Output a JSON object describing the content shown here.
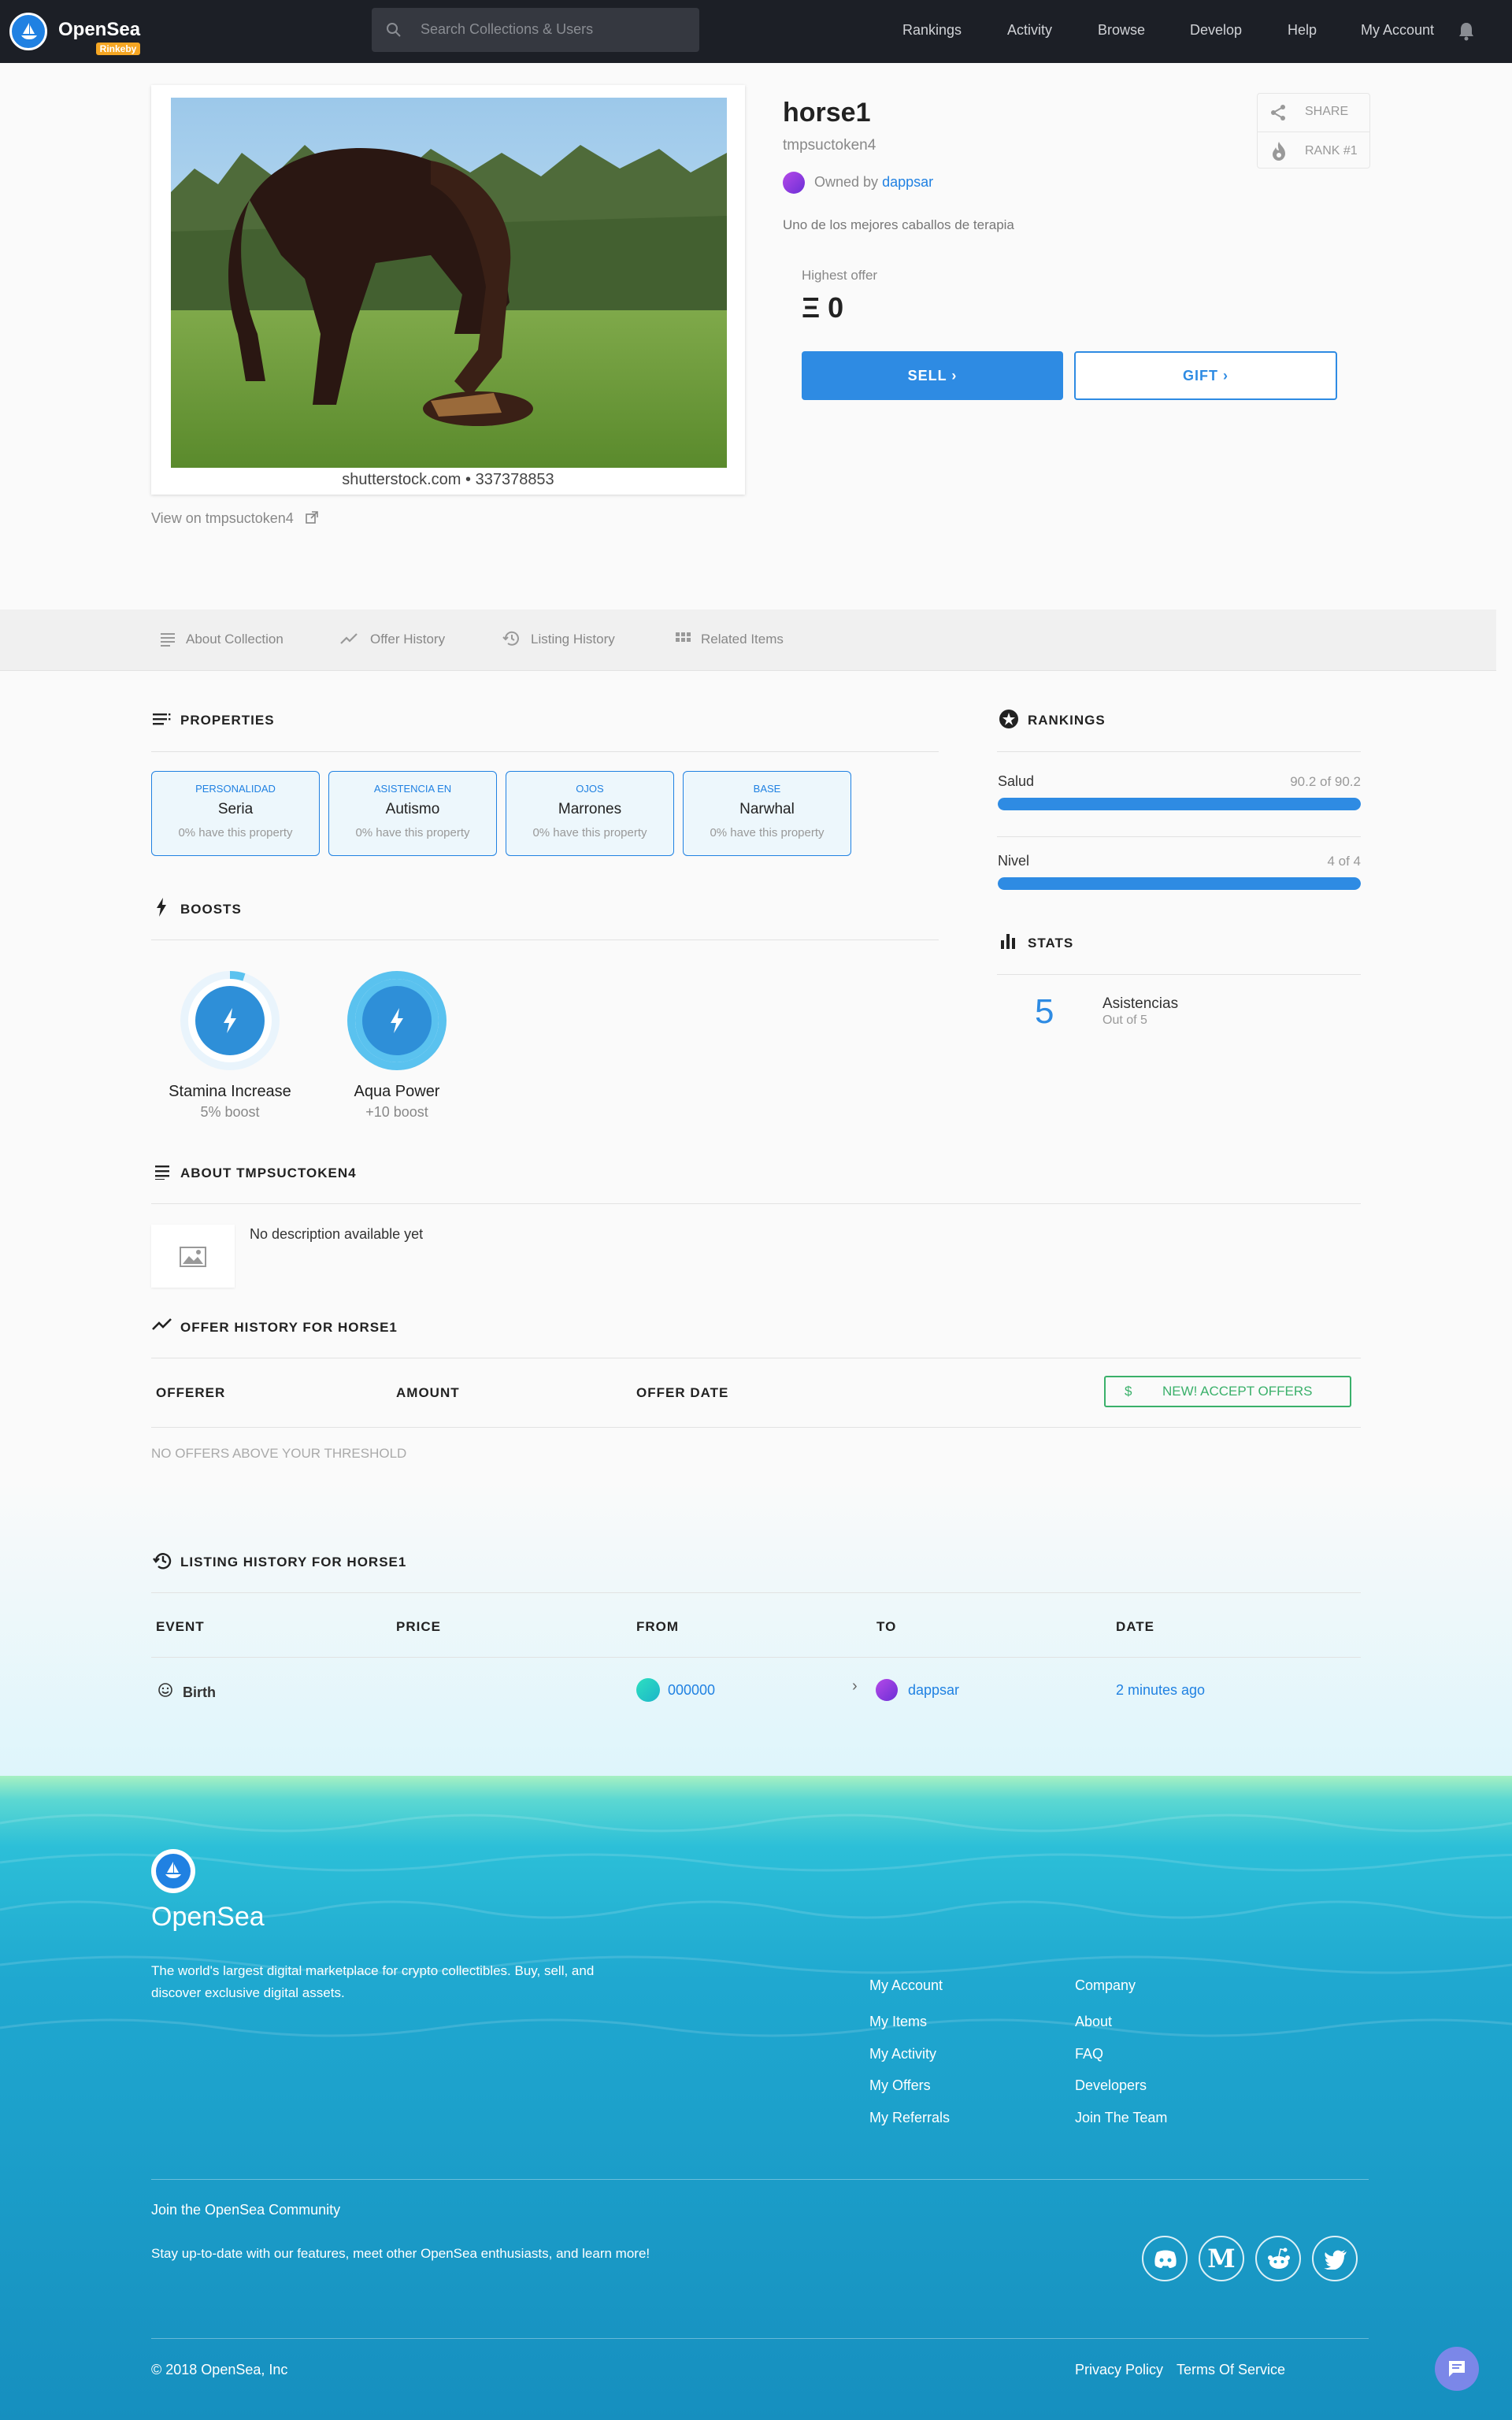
{
  "header": {
    "brand": "OpenSea",
    "network_badge": "Rinkeby",
    "search_placeholder": "Search Collections & Users",
    "nav": [
      "Rankings",
      "Activity",
      "Browse",
      "Develop",
      "Help",
      "My Account"
    ]
  },
  "asset": {
    "image_caption": "shutterstock.com • 337378853",
    "view_on": "View on tmpsuctoken4",
    "title": "horse1",
    "collection": "tmpsuctoken4",
    "owned_by_label": "Owned by",
    "owner": "dappsar",
    "description": "Uno de los mejores caballos de terapia",
    "highest_offer_label": "Highest offer",
    "highest_offer_value": "Ξ 0",
    "sell_label": "SELL",
    "gift_label": "GIFT",
    "share_label": "SHARE",
    "rank_label": "RANK #1"
  },
  "tabs": [
    "About Collection",
    "Offer History",
    "Listing History",
    "Related Items"
  ],
  "properties": {
    "heading": "PROPERTIES",
    "items": [
      {
        "type": "PERSONALIDAD",
        "value": "Seria",
        "rarity": "0% have this property"
      },
      {
        "type": "ASISTENCIA EN",
        "value": "Autismo",
        "rarity": "0% have this property"
      },
      {
        "type": "OJOS",
        "value": "Marrones",
        "rarity": "0% have this property"
      },
      {
        "type": "BASE",
        "value": "Narwhal",
        "rarity": "0% have this property"
      }
    ]
  },
  "boosts": {
    "heading": "BOOSTS",
    "items": [
      {
        "name": "Stamina Increase",
        "sub": "5% boost",
        "level": 0.05
      },
      {
        "name": "Aqua Power",
        "sub": "+10 boost",
        "level": 1.0
      }
    ]
  },
  "rankings": {
    "heading": "RANKINGS",
    "items": [
      {
        "label": "Salud",
        "value": "90.2 of 90.2",
        "fraction": 1.0
      },
      {
        "label": "Nivel",
        "value": "4 of 4",
        "fraction": 1.0
      }
    ]
  },
  "stats": {
    "heading": "STATS",
    "value": "5",
    "label": "Asistencias",
    "sub": "Out of 5"
  },
  "about": {
    "heading": "ABOUT TMPSUCTOKEN4",
    "text": "No description available yet"
  },
  "offer_history": {
    "heading": "OFFER HISTORY FOR HORSE1",
    "columns": [
      "OFFERER",
      "AMOUNT",
      "OFFER DATE"
    ],
    "accept_button": "NEW! ACCEPT OFFERS",
    "empty": "NO OFFERS ABOVE YOUR THRESHOLD"
  },
  "listing_history": {
    "heading": "LISTING HISTORY FOR HORSE1",
    "columns": [
      "EVENT",
      "PRICE",
      "FROM",
      "TO",
      "DATE"
    ],
    "rows": [
      {
        "event": "Birth",
        "from": "000000",
        "to": "dappsar",
        "date": "2 minutes ago"
      }
    ]
  },
  "footer": {
    "brand": "OpenSea",
    "tagline": "The world's largest digital marketplace for crypto collectibles. Buy, sell, and discover exclusive digital assets.",
    "col1_title": "My Account",
    "col1_links": [
      "My Items",
      "My Activity",
      "My Offers",
      "My Referrals"
    ],
    "col2_title": "Company",
    "col2_links": [
      "About",
      "FAQ",
      "Developers",
      "Join The Team"
    ],
    "community_title": "Join the OpenSea Community",
    "community_text": "Stay up-to-date with our features, meet other OpenSea enthusiasts, and learn more!",
    "copyright": "© 2018 OpenSea, Inc",
    "privacy": "Privacy Policy",
    "terms": "Terms Of Service"
  },
  "colors": {
    "accent": "#2081e2",
    "header_bg": "#1c1f26",
    "offer_green": "#3ab06a"
  }
}
